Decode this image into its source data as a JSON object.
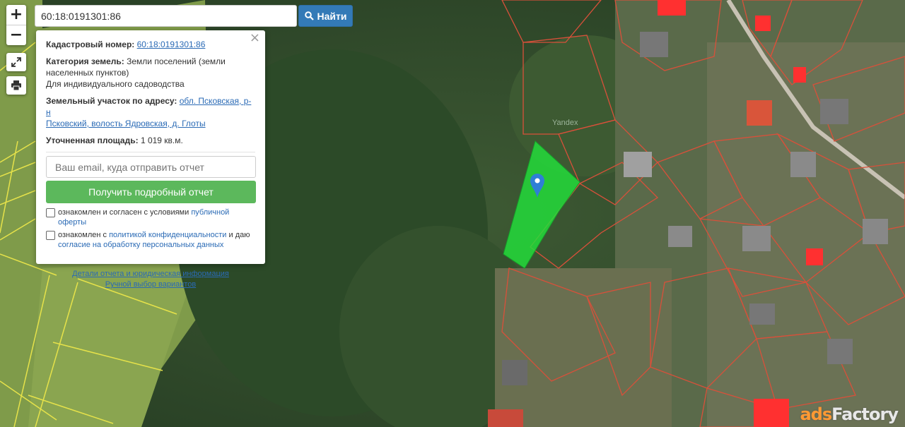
{
  "search": {
    "value": "60:18:0191301:86",
    "button_label": "Найти"
  },
  "controls": {
    "zoom_in": "+",
    "zoom_out": "−"
  },
  "popup": {
    "close": "×",
    "cadastral_label": "Кадастровый номер:",
    "cadastral_value": "60:18:0191301:86",
    "category_label": "Категория земель:",
    "category_value_1": "Земли поселений (земли",
    "category_value_2": "населенных пунктов)",
    "category_value_3": "Для индивидуального садоводства",
    "address_label": "Земельный участок по адресу:",
    "address_value_1": "обл. Псковская, р-н",
    "address_value_2": "Псковский, волость Ядровская, д. Глоты",
    "area_label": "Уточненная площадь:",
    "area_value": "1 019 кв.м.",
    "email_placeholder": "Ваш email, куда отправить отчет",
    "get_report_button": "Получить подробный отчет",
    "consent1_text": "ознакомлен и согласен с условиями ",
    "consent1_link": "публичной оферты",
    "consent2_text": "ознакомлен с ",
    "consent2_link": "политикой конфиденциальности",
    "consent2_text2": " и даю",
    "consent2_link2": "согласие на обработку персональных данных",
    "details_link": "Детали отчета и юридическая информация",
    "manual_link": "Ручной выбор вариантов"
  },
  "map": {
    "yandex_label": "Yandex",
    "selected_parcel_color": "#22e03a",
    "boundary_color": "#d9503a",
    "field_line_color": "#e6e24a"
  },
  "watermark": {
    "prefix": "ads",
    "suffix": "Factory"
  }
}
